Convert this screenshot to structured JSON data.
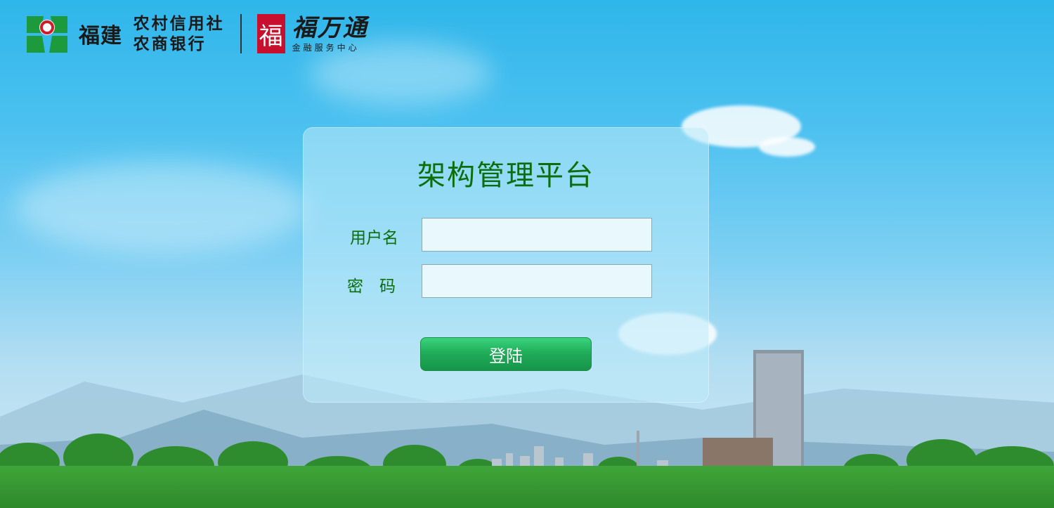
{
  "logo": {
    "bank_name_big": "福建",
    "bank_line1": "农村信用社",
    "bank_line2": "农商银行",
    "fwt_seal": "福",
    "fwt_title": "福万通",
    "fwt_subtitle": "金融服务中心"
  },
  "login": {
    "title": "架构管理平台",
    "username_label": "用户名",
    "username_value": "",
    "password_label": "密　码",
    "password_value": "",
    "submit_label": "登陆"
  },
  "colors": {
    "accent_green": "#0b6e0b",
    "button_green": "#1faa58",
    "brand_red": "#c8102e"
  }
}
